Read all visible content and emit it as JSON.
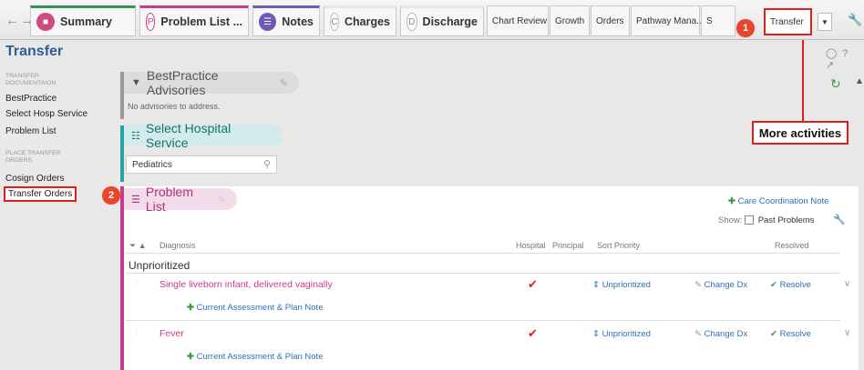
{
  "tabs": {
    "summary": "Summary",
    "problem_list": "Problem List ...",
    "notes": "Notes",
    "charges": "Charges",
    "discharge": "Discharge",
    "chart_review": "Chart Review",
    "growth": "Growth",
    "orders": "Orders",
    "pathway": "Pathway Mana...",
    "hidden_partial": "S",
    "transfer": "Transfer",
    "badge_problem": "P",
    "badge_charges": "C",
    "badge_discharge": "D"
  },
  "markers": {
    "one": "1",
    "two": "2"
  },
  "page": {
    "title": "Transfer"
  },
  "sidebar": {
    "head1": "TRANSFER DOCUMENTAION",
    "best_practice": "BestPractice",
    "select_hosp": "Select Hosp Service",
    "problem_list": "Problem List",
    "head2": "PLACE TRANSFER ORDERS",
    "cosign": "Cosign Orders",
    "transfer_orders": "Transfer Orders"
  },
  "bpa": {
    "title": "BestPractice Advisories",
    "message": "No advisories to address."
  },
  "hosp_service": {
    "title": "Select Hospital Service",
    "value": "Pediatrics"
  },
  "callout": {
    "text": "More activities"
  },
  "problem_list": {
    "title": "Problem List",
    "care_note": "Care Coordination Note",
    "show_label": "Show:",
    "past_problems": "Past Problems",
    "headers": {
      "diagnosis": "Diagnosis",
      "hospital": "Hospital",
      "principal": "Principal",
      "sort_priority": "Sort Priority",
      "resolved": "Resolved"
    },
    "group": "Unprioritized",
    "rows": [
      {
        "diagnosis": "Single liveborn infant, delivered vaginally",
        "priority": "Unprioritized",
        "change": "Change Dx",
        "resolve": "Resolve",
        "note": "Current Assessment & Plan Note"
      },
      {
        "diagnosis": "Fever",
        "priority": "Unprioritized",
        "change": "Change Dx",
        "resolve": "Resolve",
        "note": "Current Assessment & Plan Note"
      }
    ]
  },
  "colors": {
    "accent_red": "#e02020",
    "title_blue": "#2f5e8f",
    "problem_magenta": "#c43c8a",
    "hosp_teal": "#27a2a6",
    "link_blue": "#2f6fb3",
    "resolve_green": "#3c9a3c"
  }
}
